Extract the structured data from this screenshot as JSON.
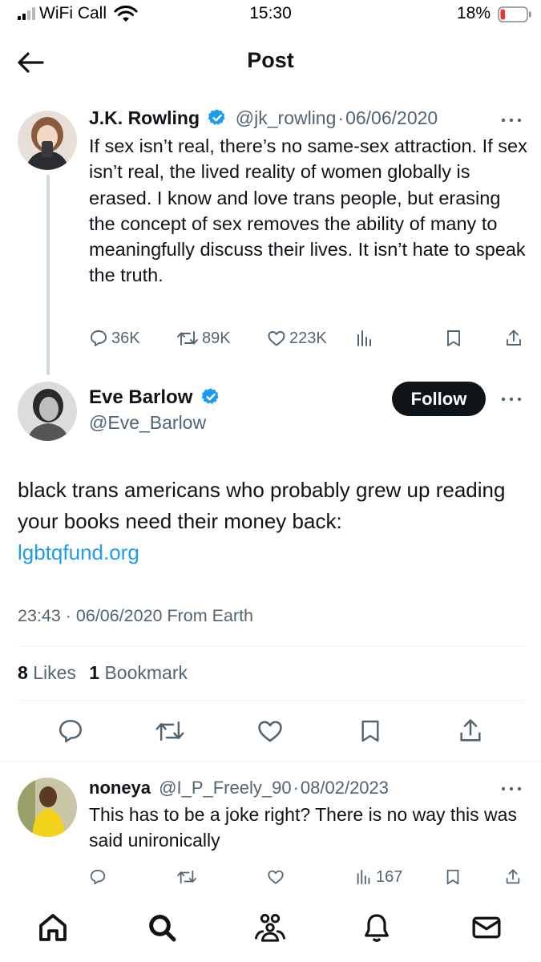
{
  "status_bar": {
    "carrier": "WiFi Call",
    "time": "15:30",
    "battery_percent": "18%",
    "battery_level": 0.18
  },
  "header": {
    "title": "Post"
  },
  "parent_tweet": {
    "name": "J.K. Rowling",
    "handle": "@jk_rowling",
    "separator": "·",
    "date": "06/06/2020",
    "text": "If sex isn’t real, there’s no same-sex attraction. If sex isn’t real, the lived reality of women globally is erased. I know and love trans people, but erasing the concept of sex removes the ability of many to meaningfully discuss their lives. It isn’t hate to speak the truth.",
    "replies": "36K",
    "reposts": "89K",
    "likes": "223K"
  },
  "main_tweet": {
    "name": "Eve Barlow",
    "handle": "@Eve_Barlow",
    "follow_label": "Follow",
    "text": "black trans americans who probably grew up reading your books need their money back:",
    "link": "lgbtqfund.org",
    "meta": "23:43 · 06/06/2020 From Earth",
    "likes_count": "8",
    "likes_label": "Likes",
    "bookmarks_count": "1",
    "bookmarks_label": "Bookmark"
  },
  "reply": {
    "name": "noneya",
    "handle": "@I_P_Freely_90",
    "separator": "·",
    "date": "08/02/2023",
    "text": "This has to be a joke right?  There is no way this was said unironically",
    "views": "167"
  },
  "colors": {
    "text": "#0f1419",
    "secondary": "#536471",
    "link": "#1d9bf0",
    "verified": "#1d9bf0",
    "divider": "#eff3f4",
    "battery_low": "#e53935"
  },
  "icons": [
    "signal-icon",
    "wifi-icon",
    "battery-icon",
    "back-arrow-icon",
    "verified-badge-icon",
    "more-icon",
    "reply-icon",
    "repost-icon",
    "like-icon",
    "views-icon",
    "bookmark-icon",
    "share-icon",
    "home-icon",
    "search-icon",
    "communities-icon",
    "notifications-icon",
    "messages-icon"
  ]
}
